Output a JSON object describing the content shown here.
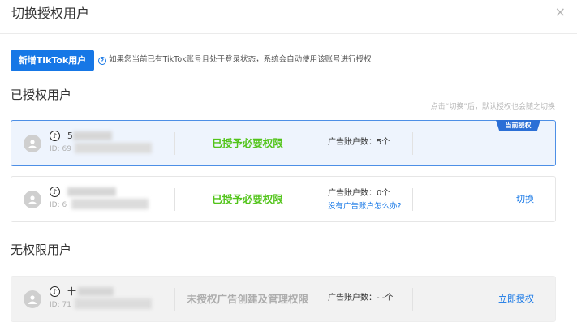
{
  "dialog": {
    "title": "切换授权用户",
    "close_icon": "×"
  },
  "toolbar": {
    "add_label": "新增TikTok用户",
    "hint_icon": "?",
    "hint": "如果您当前已有TikTok账号且处于登录状态，系统会自动使用该账号进行授权"
  },
  "authorized": {
    "title": "已授权用户",
    "note": "点击“切换”后，默认授权也会随之切换",
    "users": [
      {
        "name": "5",
        "id_prefix": "ID: 69",
        "permission": "已授予必要权限",
        "accounts": "广告账户数：5个",
        "badge": "当前授权"
      },
      {
        "name": "",
        "id_prefix": "ID: 6",
        "permission": "已授予必要权限",
        "accounts": "广告账户数：0个",
        "help_link": "没有广告账户怎么办?",
        "action": "切换"
      }
    ]
  },
  "unauthorized": {
    "title": "无权限用户",
    "users": [
      {
        "name": "十",
        "id_prefix": "ID: 71",
        "permission": "未授权广告创建及管理权限",
        "accounts": "广告账户数：- -个",
        "action": "立即授权"
      }
    ]
  },
  "icons": {
    "avatar": "user-avatar-icon",
    "platform": "tiktok-icon",
    "platform_glyph": "♪"
  },
  "colors": {
    "primary": "#1677e6",
    "success": "#52c41a",
    "current_border": "#4d8fe6",
    "current_bg": "#eef4fd"
  }
}
